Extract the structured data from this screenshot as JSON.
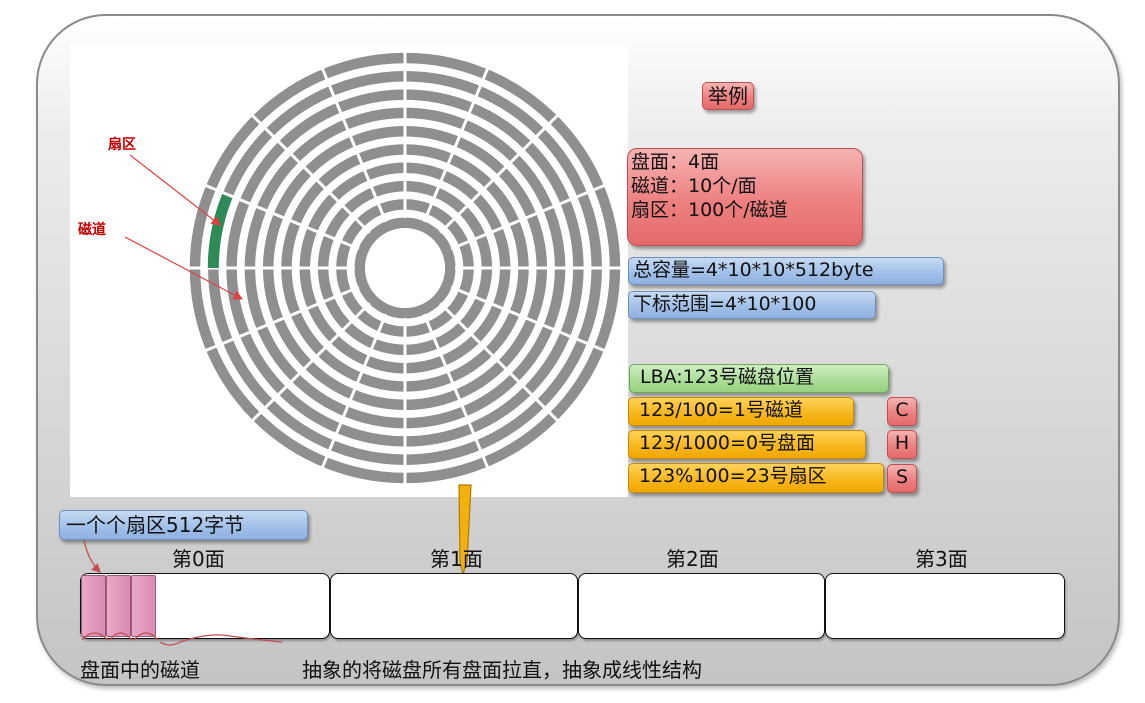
{
  "disk": {
    "sector_label": "扇区",
    "track_label": "磁道"
  },
  "example": {
    "title": "举例",
    "spec_lines": [
      "盘面：4面",
      "磁道：10个/面",
      "扇区：100个/磁道"
    ],
    "capacity": "总容量=4*10*10*512byte",
    "index_range": "下标范围=4*10*100",
    "lba": "LBA:123号磁盘位置",
    "calc_c": "123/100=1号磁道",
    "calc_h": "123/1000=0号盘面",
    "calc_s": "123%100=23号扇区",
    "tag_c": "C",
    "tag_h": "H",
    "tag_s": "S"
  },
  "linear": {
    "sector_note": "一个个扇区512字节",
    "faces": [
      "第0面",
      "第1面",
      "第2面",
      "第3面"
    ],
    "track_note": "盘面中的磁道",
    "description": "抽象的将磁盘所有盘面拉直，抽象成线性结构"
  },
  "colors": {
    "track_ring": "#8f8f8f",
    "highlight_sector": "#2e8b57",
    "arrow": "#e04040"
  }
}
